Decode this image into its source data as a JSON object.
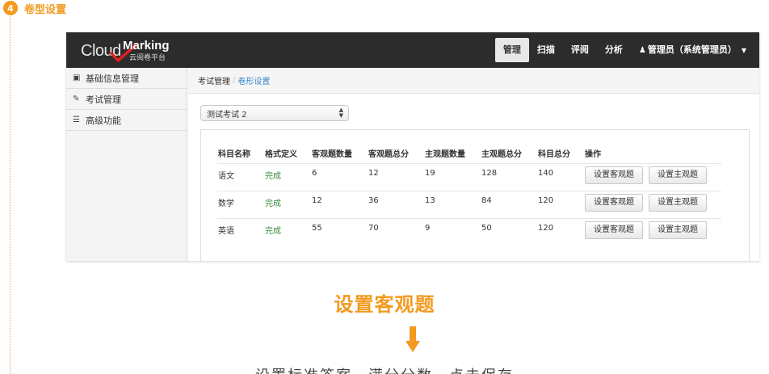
{
  "step": {
    "number": "4",
    "title": "卷型设置"
  },
  "brand": {
    "part1": "Cloud",
    "part2": "Marking",
    "subtitle": "云阅卷平台"
  },
  "navbar": {
    "items": [
      "管理",
      "扫描",
      "评阅",
      "分析"
    ],
    "active": "管理",
    "user_label": "管理员（系统管理员）"
  },
  "sidebar": {
    "items": [
      {
        "label": "基础信息管理",
        "icon": "sitemap-icon"
      },
      {
        "label": "考试管理",
        "icon": "edit-icon"
      },
      {
        "label": "高级功能",
        "icon": "list-icon"
      }
    ]
  },
  "breadcrumb": {
    "home": "考试管理",
    "separator": "/",
    "current": "卷形设置"
  },
  "exam_select": {
    "value": "测试考试 2"
  },
  "table": {
    "headers": [
      "科目名称",
      "格式定义",
      "客观题数量",
      "客观题总分",
      "主观题数量",
      "主观题总分",
      "科目总分",
      "操作"
    ],
    "rows": [
      [
        "语文",
        "完成",
        "6",
        "12",
        "19",
        "128",
        "140"
      ],
      [
        "数学",
        "完成",
        "12",
        "36",
        "13",
        "84",
        "120"
      ],
      [
        "英语",
        "完成",
        "55",
        "70",
        "9",
        "50",
        "120"
      ]
    ],
    "buttons": {
      "objective": "设置客观题",
      "subjective": "设置主观题"
    }
  },
  "caption": "设置客观题",
  "subcaption": "设置标准答案、满分分数，点击保存",
  "colors": {
    "accent": "#f39a1f",
    "navbar": "#2c2c2c",
    "done": "#3c8a3c",
    "link": "#3a87c8"
  }
}
